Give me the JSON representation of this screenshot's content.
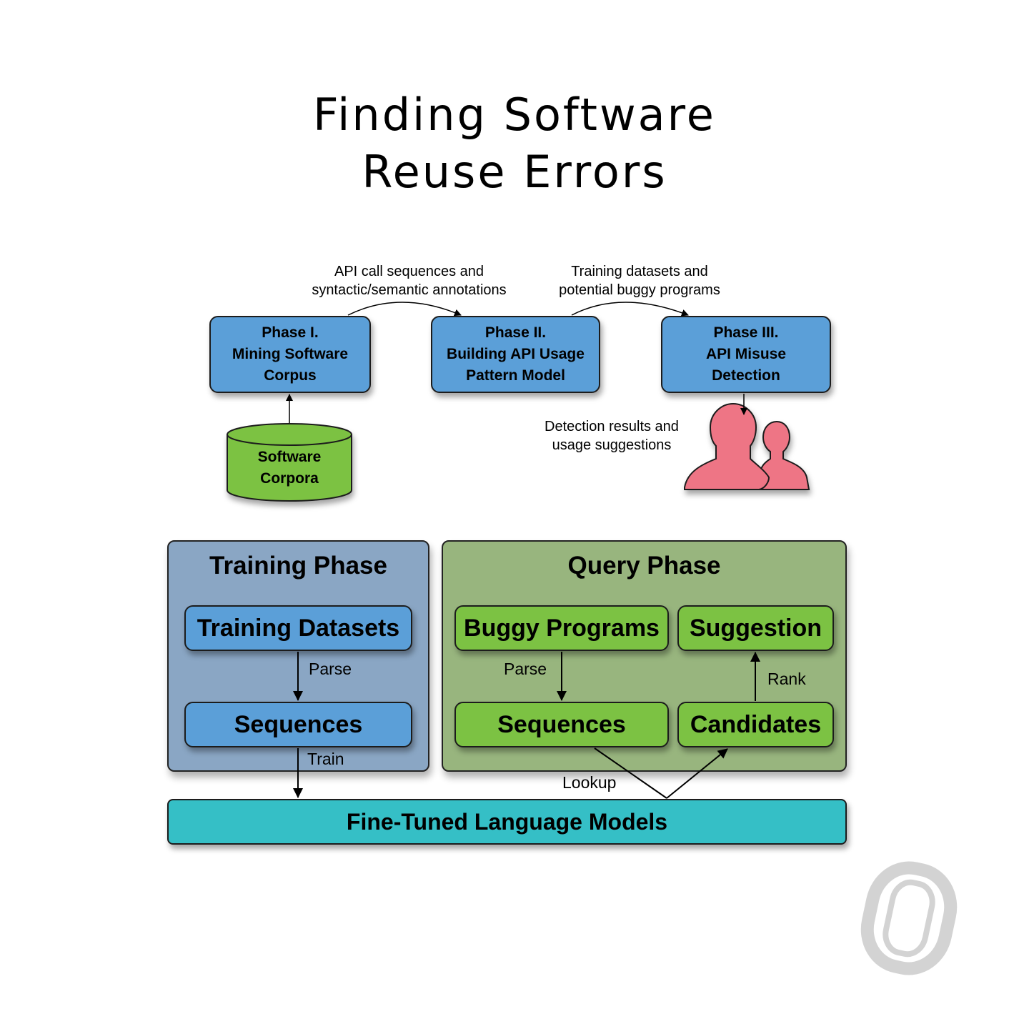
{
  "title": {
    "line1": "Finding Software",
    "line2": "Reuse Errors"
  },
  "top_flow": {
    "edge_labels": [
      "API call sequences and\nsyntactic/semantic annotations",
      "Training datasets and\npotential buggy programs"
    ],
    "phases": [
      {
        "heading": "Phase I.",
        "body": "Mining Software\nCorpus"
      },
      {
        "heading": "Phase II.",
        "body": "Building API Usage\nPattern Model"
      },
      {
        "heading": "Phase III.",
        "body": "API Misuse\nDetection"
      }
    ],
    "corpora": "Software\nCorpora",
    "output_label": "Detection results and\nusage suggestions",
    "users_icon": "users-icon"
  },
  "training_phase": {
    "title": "Training Phase",
    "datasets": "Training Datasets",
    "sequences": "Sequences",
    "parse_label": "Parse",
    "train_label": "Train"
  },
  "query_phase": {
    "title": "Query Phase",
    "buggy": "Buggy Programs",
    "suggestion": "Suggestion",
    "sequences": "Sequences",
    "candidates": "Candidates",
    "parse_label": "Parse",
    "rank_label": "Rank"
  },
  "lookup_label": "Lookup",
  "models": "Fine-Tuned Language Models",
  "logo": "university-logo-icon",
  "colors": {
    "phase_blue": "#5b9fd8",
    "training_panel": "#8aa6c4",
    "query_panel": "#98b57e",
    "green_box": "#7cc243",
    "model_teal": "#35bfc6",
    "users_pink": "#ee7585"
  }
}
